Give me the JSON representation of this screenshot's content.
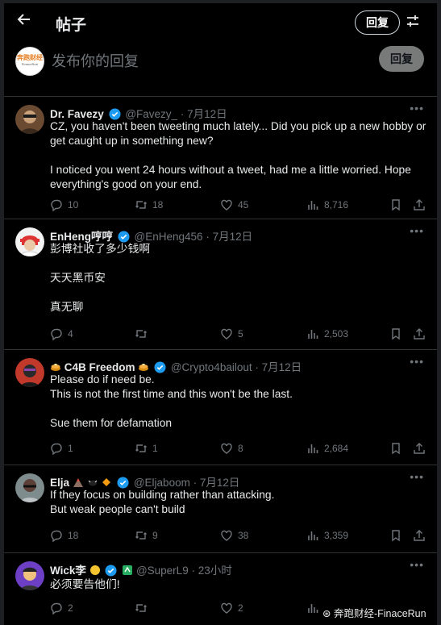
{
  "header": {
    "title": "帖子",
    "reply_label": "回复"
  },
  "compose": {
    "placeholder": "发布你的回复",
    "reply_label": "回复",
    "avatar_logo": "奔跑财经",
    "avatar_sub": "FinaceRun"
  },
  "tweets": [
    {
      "name": "Dr. Favezy",
      "handle": "@Favezy_",
      "time": "7月12日",
      "lines": [
        "CZ, you haven't been tweeting much lately... Did you pick up a new hobby or",
        "get caught up in something new?",
        "",
        "I noticed you went 24 hours without a tweet, had me a little worried. Hope",
        "everything's good on your end."
      ],
      "replies": "10",
      "retweets": "18",
      "likes": "45",
      "views": "8,716"
    },
    {
      "name": "EnHeng哼哼",
      "handle": "@EnHeng456",
      "time": "7月12日",
      "lines": [
        "彭博社收了多少钱啊",
        "",
        "天天黑币安",
        "",
        "真无聊"
      ],
      "replies": "4",
      "retweets": "",
      "likes": "5",
      "views": "2,503"
    },
    {
      "name": "C4B Freedom",
      "handle": "@Crypto4bailout",
      "time": "7月12日",
      "lines": [
        "Please do if need be.",
        "This is not the first time and this won't be the last.",
        "",
        "Sue them for defamation"
      ],
      "replies": "1",
      "retweets": "1",
      "likes": "8",
      "views": "2,684"
    },
    {
      "name": "Elja",
      "handle": "@Eljaboom",
      "time": "7月12日",
      "lines": [
        "If they focus on building rather than attacking.",
        "But weak people can't build"
      ],
      "replies": "18",
      "retweets": "9",
      "likes": "38",
      "views": "3,359"
    },
    {
      "name": "Wick李",
      "handle": "@SuperL9",
      "time": "23小时",
      "lines": [
        "必须要告他们!"
      ],
      "replies": "2",
      "retweets": "",
      "likes": "2",
      "views": ""
    }
  ],
  "separator": "·",
  "watermark": "奔跑财经-FinaceRun",
  "colors": {
    "background": "#000000",
    "accent_verified": "#1d9bf0",
    "muted": "#71767b"
  }
}
